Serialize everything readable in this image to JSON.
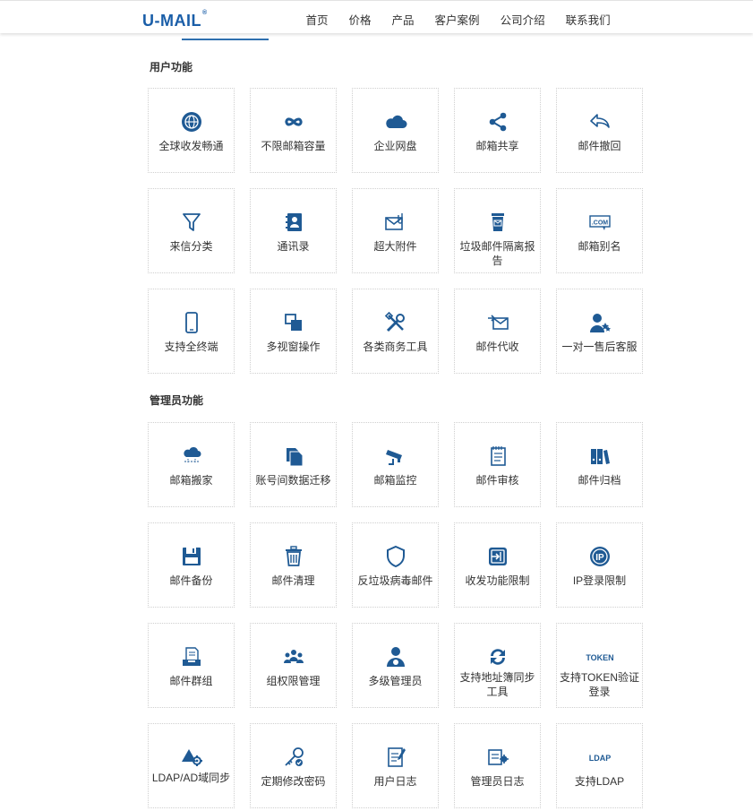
{
  "header": {
    "logo": "U-MAIL",
    "logo_mark": "®",
    "nav": [
      "首页",
      "价格",
      "产品",
      "客户案例",
      "公司介绍",
      "联系我们"
    ]
  },
  "colors": {
    "accent": "#2f6fae",
    "icon": "#1f5a94"
  },
  "user_section": {
    "title": "用户功能",
    "items": [
      {
        "label": "全球收发畅通",
        "icon": "globe-icon"
      },
      {
        "label": "不限邮箱容量",
        "icon": "infinity-icon"
      },
      {
        "label": "企业网盘",
        "icon": "cloud-icon"
      },
      {
        "label": "邮箱共享",
        "icon": "share-icon"
      },
      {
        "label": "邮件撤回",
        "icon": "undo-arrow-icon"
      },
      {
        "label": "来信分类",
        "icon": "funnel-icon"
      },
      {
        "label": "通讯录",
        "icon": "address-book-icon"
      },
      {
        "label": "超大附件",
        "icon": "envelope-attachment-icon"
      },
      {
        "label": "垃圾邮件隔离报告",
        "icon": "trash-mail-icon"
      },
      {
        "label": "邮箱别名",
        "icon": "dotcom-icon"
      },
      {
        "label": "支持全终端",
        "icon": "mobile-phone-icon"
      },
      {
        "label": "多视窗操作",
        "icon": "multi-window-icon"
      },
      {
        "label": "各类商务工具",
        "icon": "tools-icon"
      },
      {
        "label": "邮件代收",
        "icon": "mail-collect-icon"
      },
      {
        "label": "一对一售后客服",
        "icon": "customer-service-icon"
      }
    ]
  },
  "admin_section": {
    "title": "管理员功能",
    "items": [
      {
        "label": "邮箱搬家",
        "icon": "cloud-move-icon"
      },
      {
        "label": "账号间数据迁移",
        "icon": "documents-icon"
      },
      {
        "label": "邮箱监控",
        "icon": "camera-icon"
      },
      {
        "label": "邮件审核",
        "icon": "notepad-icon"
      },
      {
        "label": "邮件归档",
        "icon": "binders-icon"
      },
      {
        "label": "邮件备份",
        "icon": "floppy-icon"
      },
      {
        "label": "邮件清理",
        "icon": "trash-can-icon"
      },
      {
        "label": "反垃圾病毒邮件",
        "icon": "shield-icon"
      },
      {
        "label": "收发功能限制",
        "icon": "restrict-icon"
      },
      {
        "label": "IP登录限制",
        "icon": "ip-icon"
      },
      {
        "label": "邮件群组",
        "icon": "mail-group-icon"
      },
      {
        "label": "组权限管理",
        "icon": "group-icon"
      },
      {
        "label": "多级管理员",
        "icon": "admin-user-icon"
      },
      {
        "label": "支持地址簿同步工具",
        "icon": "sync-icon"
      },
      {
        "label": "支持TOKEN验证登录",
        "icon": "token-icon",
        "icon_text": "TOKEN"
      },
      {
        "label": "LDAP/AD域同步",
        "icon": "ldap-sync-icon"
      },
      {
        "label": "定期修改密码",
        "icon": "key-icon"
      },
      {
        "label": "用户日志",
        "icon": "user-log-icon"
      },
      {
        "label": "管理员日志",
        "icon": "admin-log-icon"
      },
      {
        "label": "支持LDAP",
        "icon": "ldap-icon",
        "icon_text": "LDAP"
      }
    ]
  }
}
